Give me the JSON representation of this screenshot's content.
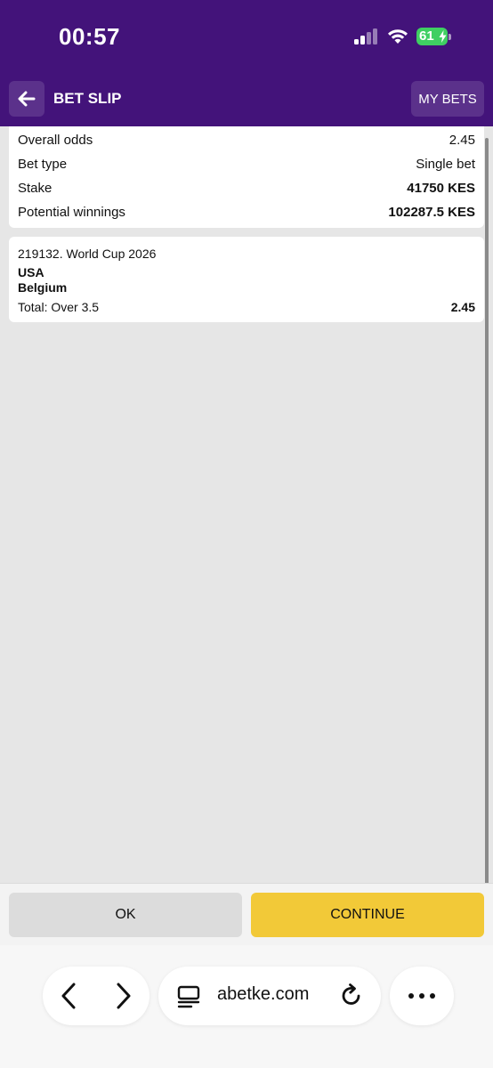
{
  "status_bar": {
    "time": "00:57",
    "battery": "61"
  },
  "header": {
    "title": "BET SLIP",
    "my_bets_label": "MY BETS"
  },
  "summary": {
    "rows": [
      {
        "label": "Overall odds",
        "value": "2.45"
      },
      {
        "label": "Bet type",
        "value": "Single bet"
      },
      {
        "label": "Stake",
        "value": "41750 KES"
      },
      {
        "label": "Potential winnings",
        "value": "102287.5 KES"
      }
    ]
  },
  "event": {
    "id_line": "219132. World Cup 2026",
    "team1": "USA",
    "team2": "Belgium",
    "market": "Total: Over 3.5",
    "odds": "2.45"
  },
  "actions": {
    "ok_label": "OK",
    "continue_label": "CONTINUE"
  },
  "browser": {
    "url": "abetke.com"
  },
  "colors": {
    "header_bg": "#43137a",
    "continue_bg": "#f2c938",
    "ok_bg": "#dcdcdc"
  }
}
